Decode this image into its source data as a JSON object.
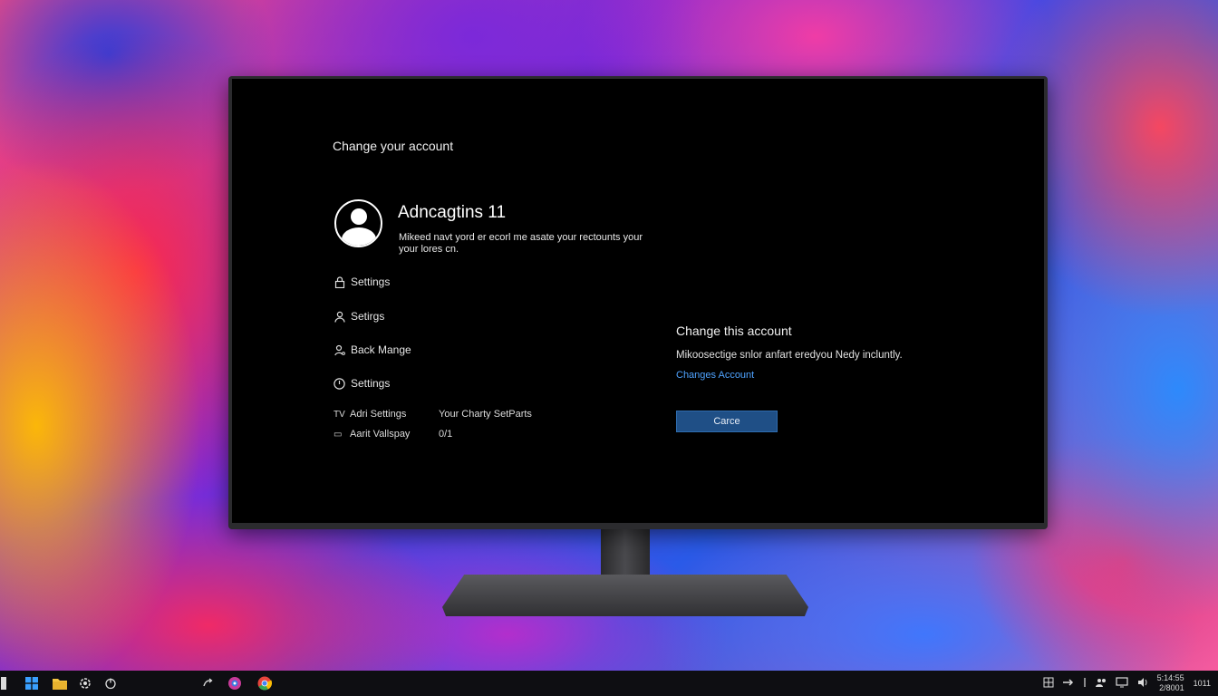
{
  "screen": {
    "heading": "Change your account",
    "account": {
      "name": "Adncagtins 11",
      "description": "Mikeed navt yord er ecorl me asate your rectounts your your lores cn."
    },
    "menu": [
      {
        "label": "Settings",
        "icon": "lock-icon"
      },
      {
        "label": "Setirgs",
        "icon": "person-icon"
      },
      {
        "label": "Back Mange",
        "icon": "person-key-icon"
      },
      {
        "label": "Settings",
        "icon": "power-icon"
      }
    ],
    "bottom_rows": [
      {
        "icon_text": "TV",
        "label": "Adri Settings",
        "value": "Your Charty SetParts"
      },
      {
        "icon_text": "▭",
        "label": "Aarit Vallspay",
        "value": "0/1"
      }
    ],
    "panel": {
      "title": "Change this account",
      "description": "Mikoosectige snlor anfart eredyou Nedy incluntly.",
      "link": "Changes Account",
      "button": "Carce"
    }
  },
  "taskbar": {
    "icons": [
      "windows-start-icon",
      "task-view-icon",
      "file-explorer-icon",
      "settings-icon",
      "power-icon",
      "share-icon",
      "app-icon",
      "chrome-icon"
    ],
    "tray": {
      "time": "5:14:55",
      "date": "2/8001"
    },
    "tray_right_text": "1011"
  },
  "colors": {
    "screen_bg": "#000000",
    "link": "#4fa3ff",
    "button_bg": "#1f4f86",
    "taskbar_bg": "#0e0e12"
  }
}
